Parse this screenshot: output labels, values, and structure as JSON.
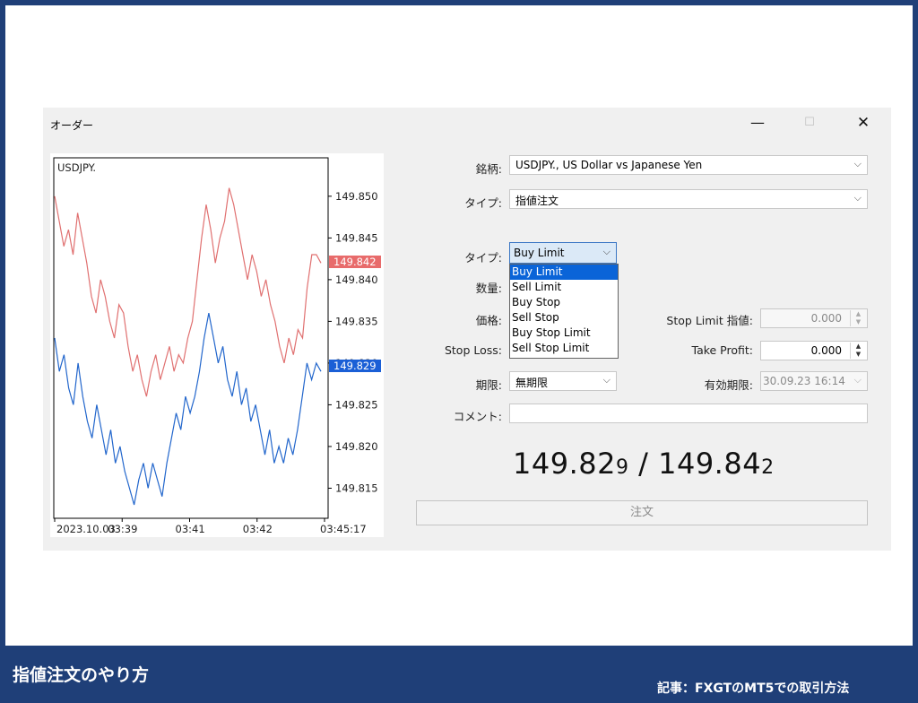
{
  "window": {
    "title": "オーダー"
  },
  "chart": {
    "symbol": "USDJPY.",
    "bid_tag": "149.829",
    "ask_tag": "149.842"
  },
  "chart_data": {
    "type": "line",
    "title": "USDJPY.",
    "x_ticks": [
      "2023.10.03",
      "03:39",
      "03:41",
      "03:42",
      "03:45:17"
    ],
    "y_ticks": [
      149.85,
      149.845,
      149.84,
      149.835,
      149.83,
      149.825,
      149.82,
      149.815
    ],
    "y_tick_labels": [
      "149.850",
      "149.845",
      "149.840",
      "149.835",
      "149.830",
      "149.825",
      "149.820",
      "149.815"
    ],
    "ylim": [
      149.8115,
      149.8545
    ],
    "series": [
      {
        "values": [
          149.85,
          149.847,
          149.844,
          149.846,
          149.843,
          149.848,
          149.845,
          149.842,
          149.838,
          149.836,
          149.84,
          149.838,
          149.835,
          149.833,
          149.837,
          149.836,
          149.832,
          149.829,
          149.831,
          149.828,
          149.826,
          149.829,
          149.831,
          149.828,
          149.83,
          149.832,
          149.829,
          149.831,
          149.83,
          149.833,
          149.835,
          149.84,
          149.845,
          149.849,
          149.846,
          149.842,
          149.845,
          149.847,
          149.851,
          149.849,
          149.846,
          149.843,
          149.84,
          149.843,
          149.841,
          149.838,
          149.84,
          149.837,
          149.835,
          149.832,
          149.83,
          149.833,
          149.831,
          149.834,
          149.833,
          149.839,
          149.843,
          149.843,
          149.842
        ]
      },
      {
        "values": [
          149.833,
          149.829,
          149.831,
          149.827,
          149.825,
          149.83,
          149.826,
          149.823,
          149.821,
          149.825,
          149.822,
          149.819,
          149.822,
          149.818,
          149.82,
          149.817,
          149.815,
          149.813,
          149.816,
          149.818,
          149.815,
          149.818,
          149.816,
          149.814,
          149.818,
          149.821,
          149.824,
          149.822,
          149.826,
          149.824,
          149.826,
          149.829,
          149.833,
          149.836,
          149.833,
          149.83,
          149.832,
          149.828,
          149.826,
          149.829,
          149.825,
          149.827,
          149.823,
          149.825,
          149.822,
          149.819,
          149.822,
          149.818,
          149.82,
          149.818,
          149.821,
          149.819,
          149.822,
          149.826,
          149.83,
          149.828,
          149.83,
          149.829
        ]
      }
    ],
    "colors": [
      "#e07070",
      "#2266cc"
    ]
  },
  "form": {
    "symbol_label": "銘柄:",
    "symbol_value": "USDJPY., US Dollar vs Japanese Yen",
    "type_label": "タイプ:",
    "type_value": "指値注文",
    "order_type_label": "タイプ:",
    "order_type_value": "Buy Limit",
    "order_type_options": [
      "Buy Limit",
      "Sell Limit",
      "Buy Stop",
      "Sell Stop",
      "Buy Stop Limit",
      "Sell Stop Limit"
    ],
    "volume_label": "数量:",
    "price_label": "価格:",
    "stop_limit_label": "Stop Limit 指値:",
    "stop_limit_value": "0.000",
    "stop_loss_label": "Stop Loss:",
    "take_profit_label": "Take Profit:",
    "take_profit_value": "0.000",
    "expiry_label": "期限:",
    "expiry_value": "無期限",
    "expiry_date_label": "有効期限:",
    "expiry_date_value": "30.09.23 16:14",
    "comment_label": "コメント:",
    "comment_value": ""
  },
  "quote": {
    "bid_main": "149.82",
    "bid_small": "9",
    "separator": "/",
    "ask_main": "149.84",
    "ask_small": "2"
  },
  "order_button": "注文",
  "footer": {
    "title": "指値注文のやり方",
    "article": "記事：FXGTのMT5での取引方法"
  },
  "colors": {
    "frame": "#1f3f78",
    "ask_line": "#e07070",
    "bid_line": "#2266cc",
    "selection": "#0a64d8"
  }
}
